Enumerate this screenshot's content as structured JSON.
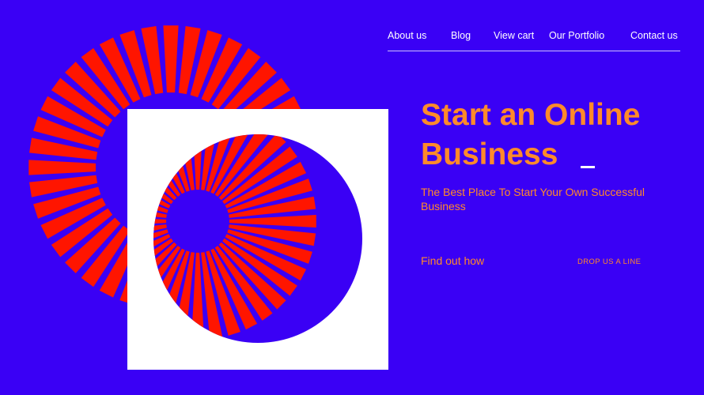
{
  "nav": {
    "items": [
      {
        "label": "About us"
      },
      {
        "label": "Blog"
      },
      {
        "label": "View cart"
      },
      {
        "label": "Our Portfolio"
      },
      {
        "label": "Contact us"
      }
    ]
  },
  "hero": {
    "title": "Start an Online Business",
    "subtitle": "The Best Place To Start Your Own Successful Business"
  },
  "cta": {
    "primary": "Find out how",
    "secondary": "DROP US A LINE"
  },
  "colors": {
    "background": "#3a00f5",
    "accent": "#ff8a2a",
    "ray": "#ff1500",
    "panel": "#ffffff"
  }
}
